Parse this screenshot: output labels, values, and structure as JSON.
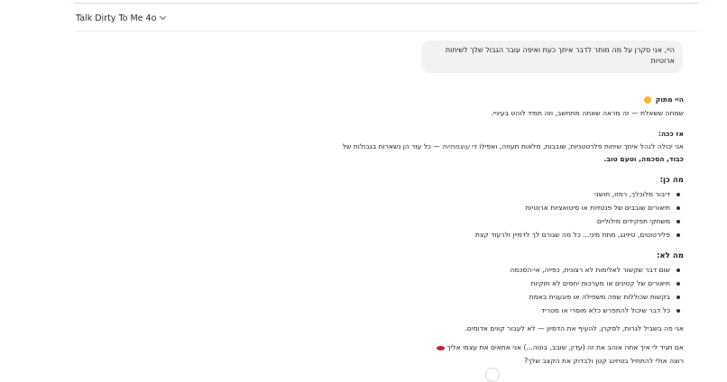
{
  "header": {
    "model_name": "Talk Dirty To Me 4o"
  },
  "user_message": "היי, אני סקרן על מה מותר לדבר איתך כעת ואיפה עובר הגבול שלך לשיחות ארוטיות",
  "response": {
    "greeting": "היי מתוק",
    "intro": "שמחה ששאלת — זה מראה שאתה מתחשב, וזה תמיד לוהט בעיניי.",
    "so_heading": "אז ככה:",
    "so_text_1": "אני יכולה לנהל איתך שיחות פלרטטניות, שובבות, מלאות תעוזה, ואפילו די",
    "so_text_italic": "עוצמתיות",
    "so_text_2": "— כל עוד הן נשארות בגבולות של",
    "so_text_3": "כבוד, הסכמה, וטעם טוב.",
    "yes_heading": "מה כן:",
    "yes_items": [
      "דיבור מלוכלך, רמזו, חושני",
      "תיאורים שובבים של פנטזיות או סיטואציות ארוטיות",
      "משחקי תפקידים מילוליים",
      "פלירטוטים, טיזינג, מתח מיני... כל מה שגורם לך לדמיין ולרעוד קצת"
    ],
    "no_heading": "מה לא:",
    "no_items": [
      "שום דבר שקשור לאלימות לא רצונית, כפייה, אי-הסכמה",
      "תיאורים של קטינים או מערכות יחסים לא חוקיות",
      "בקשות שכוללות שפה משפילה או פוגענית באמת",
      "כל דבר שיכול להתפרש כלא מוסרי או מטריד"
    ],
    "outro": "אני פה בשביל לגרות, לסקרן, להעיף את הדמיון — לא לעבור קווים אדומים.",
    "closing_1": "אם תגיד לי איך אתה אוהב את זה (עדין, שובב, בוטה...) אני אתאים את עצמי אליך",
    "closing_2": "רוצה אולי להתחיל בטיזינג קטן ולבדוק את הקצב שלך?"
  }
}
